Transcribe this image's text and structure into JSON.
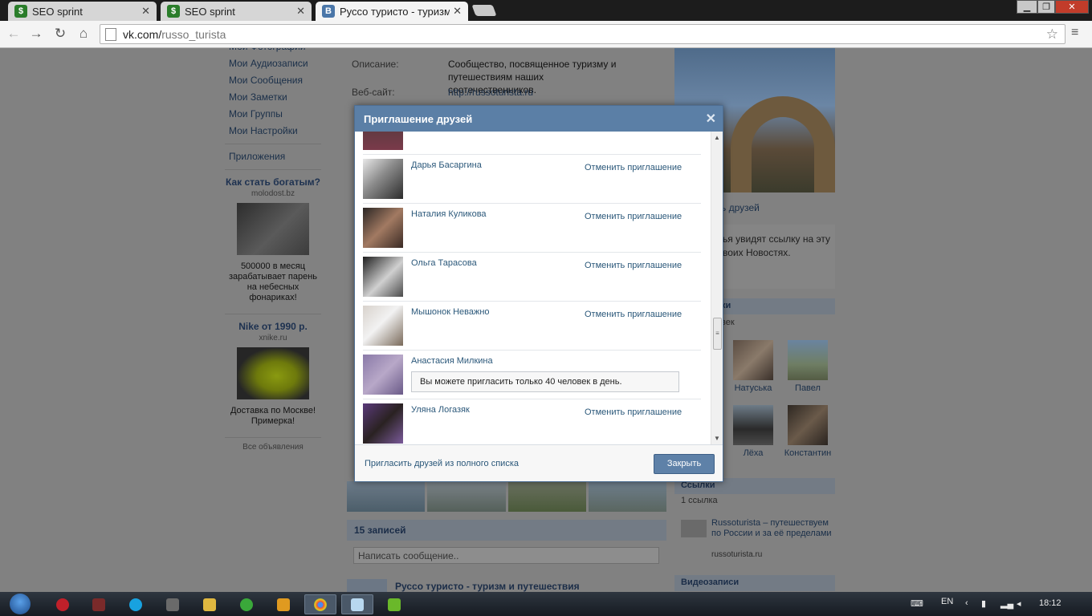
{
  "browser": {
    "tabs": [
      {
        "title": "SEO sprint",
        "favicon": "seo-sprint-icon",
        "active": false
      },
      {
        "title": "SEO sprint",
        "favicon": "seo-sprint-icon",
        "active": false
      },
      {
        "title": "Руссо туристо - туризм и",
        "favicon": "vk-icon",
        "active": true
      }
    ],
    "url_host": "vk.com/",
    "url_path": "russo_turista"
  },
  "left_nav": {
    "items": [
      "Мои Фотографии",
      "Мои Аудиозаписи",
      "Мои Сообщения",
      "Мои Заметки",
      "Мои Группы",
      "Мои Настройки"
    ],
    "apps": "Приложения",
    "ads": [
      {
        "title": "Как стать богатым?",
        "domain": "molodost.bz",
        "text": "500000 в месяц зарабатывает парень на небесных фонариках!"
      },
      {
        "title": "Nike от 1990 р.",
        "domain": "xnike.ru",
        "text": "Доставка по Москве! Примерка!"
      }
    ],
    "all_ads": "Все объявления"
  },
  "info": {
    "description_key": "Описание:",
    "description_value": "Сообщество, посвященное туризму и путешествиям наших соотечественников.",
    "website_key": "Веб-сайт:",
    "website_value": "http://russoturista.ru"
  },
  "wall": {
    "header": "15 записей",
    "input_placeholder": "Написать сообщение..",
    "post_author": "Руссо туристо - туризм и путешествия"
  },
  "right_col": {
    "invite_link": "ь друзей",
    "invite_text": "ья увидят ссылку на эту\nвоих Новостях.",
    "members_header": "ки",
    "members_count": "век",
    "friends": [
      {
        "name": "Натуська"
      },
      {
        "name": "Павел"
      },
      {
        "name": "Лёха"
      },
      {
        "name": "Константин"
      }
    ],
    "links_header": "Ссылки",
    "links_count": "1 ссылка",
    "link_title": "Russoturista – путешествуем по России и за её пределами",
    "link_domain": "russoturista.ru",
    "videos_header": "Видеозаписи"
  },
  "modal": {
    "title": "Приглашение друзей",
    "cancel_label": "Отменить приглашение",
    "rows": [
      {
        "name": "",
        "action": ""
      },
      {
        "name": "Дарья Басаргина",
        "action": "Отменить приглашение"
      },
      {
        "name": "Наталия Куликова",
        "action": "Отменить приглашение"
      },
      {
        "name": "Ольга Тарасова",
        "action": "Отменить приглашение"
      },
      {
        "name": "Мышонок Неважно",
        "action": "Отменить приглашение"
      },
      {
        "name": "Анастасия Милкина",
        "action": "",
        "warning": "Вы можете пригласить только 40 человек в день."
      },
      {
        "name": "Уляна Логазяк",
        "action": "Отменить приглашение"
      }
    ],
    "footer_link": "Пригласить друзей из полного списка",
    "close_button": "Закрыть"
  },
  "taskbar": {
    "lang": "EN",
    "clock": "18:12"
  }
}
